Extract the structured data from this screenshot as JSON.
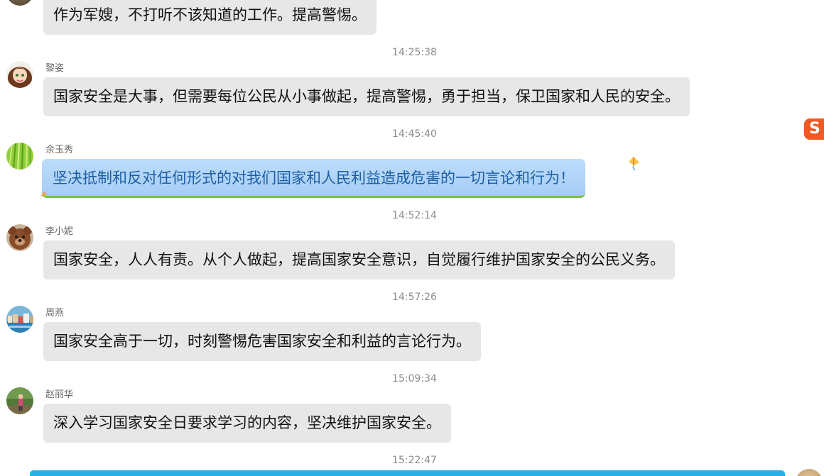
{
  "colors": {
    "bubble_bg": "#e7e7e7",
    "special_bubble_bg": "#b4d7f8",
    "special_text": "#1d5fa3",
    "timestamp": "#8c8c8c",
    "bottom_bar": "#2ab0e6",
    "side_logo": "#ee5a24"
  },
  "side_logo": {
    "icon": "sogou-logo-icon",
    "text": "S"
  },
  "messages": [
    {
      "sender": "",
      "text": "作为军嫂，不打听不该知道的工作。提高警惕。",
      "avatar": "avatar-icon"
    },
    {
      "timestamp": "14:25:38",
      "sender": "黎姿",
      "text": "国家安全是大事，但需要每位公民从小事做起，提高警惕，勇于担当，保卫国家和人民的安全。",
      "avatar": "cartoon-girl-avatar-icon"
    },
    {
      "timestamp": "14:45:40",
      "sender": "余玉秀",
      "text": "坚决抵制和反对任何形式的对我们国家和人民利益造成危害的一切言论和行为！",
      "avatar": "green-grass-avatar-icon"
    },
    {
      "timestamp": "14:52:14",
      "sender": "李小妮",
      "text": "国家安全，人人有责。从个人做起，提高国家安全意识，自觉履行维护国家安全的公民义务。",
      "avatar": "teddy-bear-avatar-icon"
    },
    {
      "timestamp": "14:57:26",
      "sender": "周燕",
      "text": "国家安全高于一切，时刻警惕危害国家安全和利益的言论行为。",
      "avatar": "coastal-town-avatar-icon"
    },
    {
      "timestamp": "15:09:34",
      "sender": "赵丽华",
      "text": "深入学习国家安全日要求学习的内容，坚决维护国家安全。",
      "avatar": "person-outdoor-avatar-icon"
    },
    {
      "timestamp": "15:22:47"
    }
  ]
}
